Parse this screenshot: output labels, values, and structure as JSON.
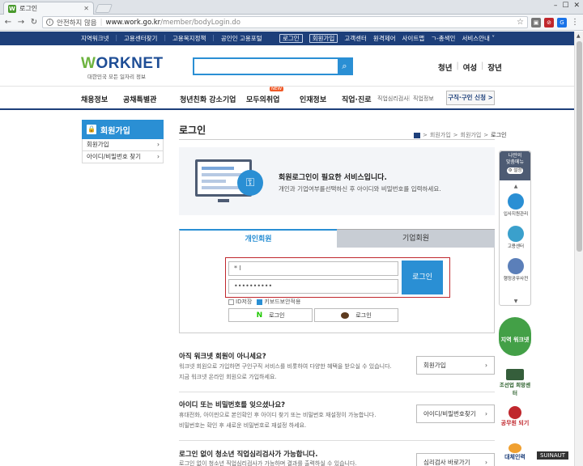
{
  "browser": {
    "tab_title": "로그인",
    "tab_favicon": "W",
    "url_insecure": "안전하지 않음",
    "url_host": "www.work.go.kr",
    "url_path": "/member/bodyLogin.do"
  },
  "utilbar": {
    "left": [
      "지역워크넷",
      "고용센터찾기",
      "고용복지정책",
      "공인인 고용포털"
    ],
    "login": "로그인",
    "join": "회원가입",
    "right": [
      "고객센터",
      "원격제어",
      "사이트맵",
      "ㄱ-총색인",
      "서비스안내 ˅"
    ]
  },
  "header": {
    "logo_main": "ORKNET",
    "logo_w": "W",
    "logo_sub": "대한민국 모든 일자리 정보",
    "targets": [
      "청년",
      "여성",
      "장년"
    ]
  },
  "mainnav": {
    "items": [
      "채용정보",
      "공채특별관",
      "청년친화 강소기업",
      "모두의취업",
      "인재정보",
      "직업·진로"
    ],
    "small": [
      "직업심리검사",
      "직업정보"
    ],
    "new_badge": "NEW",
    "cta": "구직·구인 신청 >"
  },
  "sidebar": {
    "title": "회원가입",
    "items": [
      "회원가입",
      "아이디/비밀번호 찾기"
    ]
  },
  "content": {
    "page_title": "로그인",
    "breadcrumb": [
      "회원가입",
      "회원가입",
      "로그인"
    ],
    "intro_heading": "회원로그인이 필요한 서비스입니다.",
    "intro_text": "개인과 기업여부를선택하신 후 아이디와 비밀번호를 입력하세요."
  },
  "login": {
    "tab_personal": "개인회원",
    "tab_company": "기업회원",
    "id_value": "*    l",
    "pw_value": "••••••••••",
    "login_button": "로그인",
    "save_id": "ID저장",
    "keyboard_security": "키보드보안적용",
    "naver_letter": "N",
    "naver_login": "로그인",
    "kakao_login": "로그인"
  },
  "help": [
    {
      "heading": "아직 워크넷 회원이 아니세요?",
      "text": [
        "워크넷 회원으로 가입하면 구인구직 서비스를 비롯하여 다양한 혜택을 받으실 수 있습니다.",
        "지금 워크넷 온라인 회원으로 가입하세요."
      ],
      "button": "회원가입"
    },
    {
      "heading": "아이디 또는 비밀번호를 잊으셨나요?",
      "text": [
        "휴대전화, 아이핀으로 본인확인 후 아이디 찾기 또는 비밀번호 재설정이 가능합니다.",
        "비밀번호는 확인 후 새로운 비밀번호로 재설정 하세요."
      ],
      "button": "아이디/비밀번호찾기"
    },
    {
      "heading": "로그인 없이 청소년 직업심리검사가 가능합니다.",
      "text": [
        "로그인 없이 청소년 직업심리검사가 가능하며 결과를 출력하실 수 있습니다."
      ],
      "button": "심리검사 바로가기"
    }
  ],
  "quickmenu": {
    "top_line1": "나만의",
    "top_line2": "맞춤메뉴",
    "top_btn": "설정",
    "items": [
      "입사지원관리",
      "고용센터",
      "행정공무사전"
    ],
    "badges": [
      "지역 워크넷",
      "조선업 희망센터",
      "공무원 되기",
      "대체인력"
    ]
  },
  "watermark": "SUINAUT",
  "colors": {
    "navy": "#1d3f7a",
    "blue": "#2a8fd4",
    "red": "#c0272d",
    "green": "#43a047"
  }
}
